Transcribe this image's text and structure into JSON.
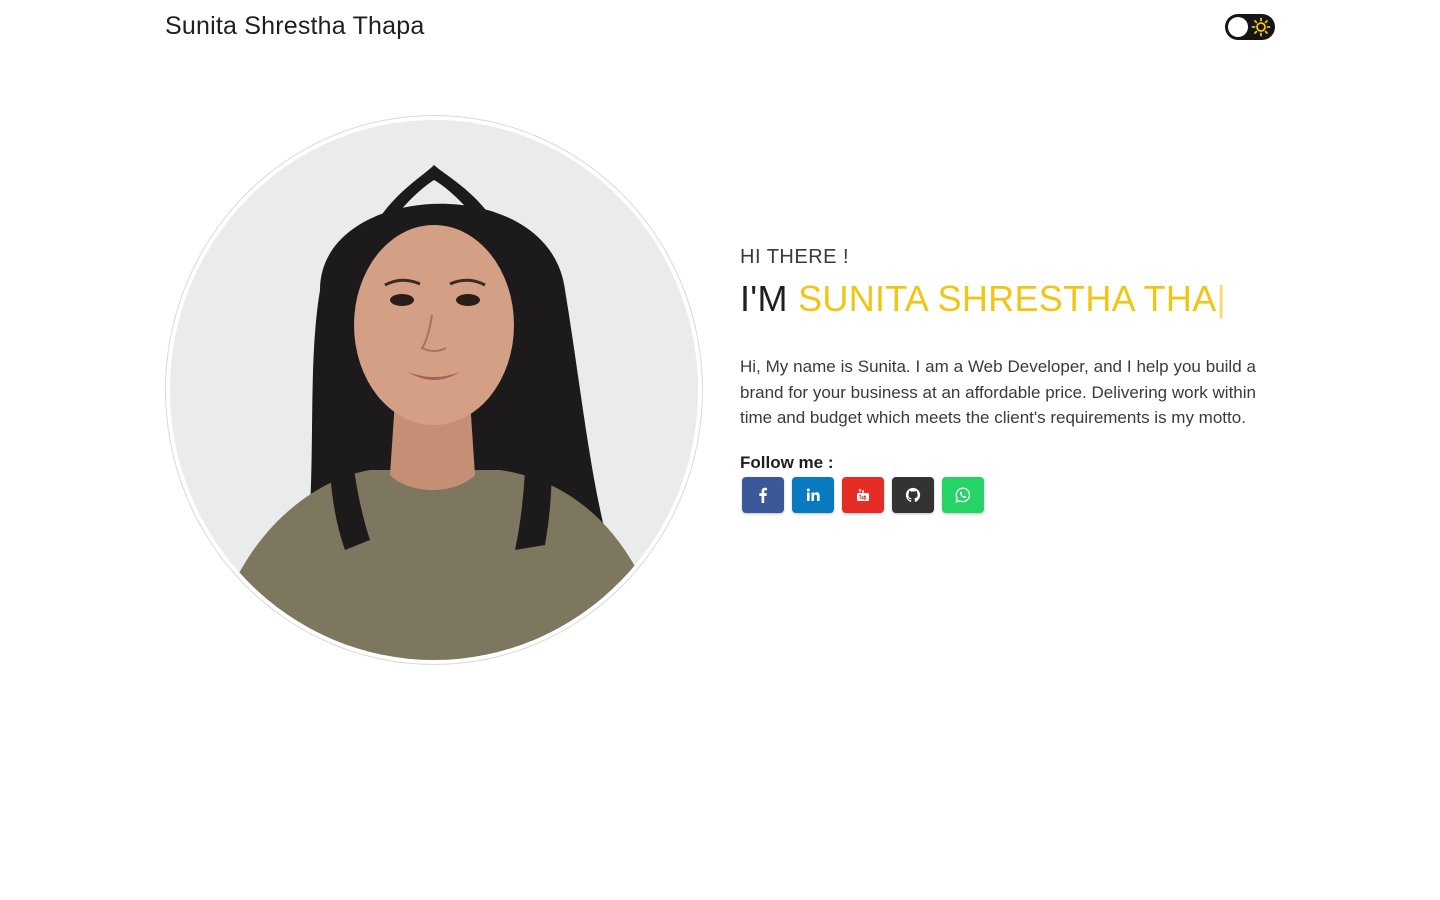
{
  "navbar": {
    "brand": "Sunita Shrestha Thapa",
    "theme_toggle_icon": "sun-icon"
  },
  "hero": {
    "greeting": "HI THERE !",
    "headline_prefix": "I'M ",
    "headline_name": "SUNITA SHRESTHA THA",
    "cursor": "|",
    "bio": "Hi, My name is Sunita. I am a Web Developer, and I help you build a brand for your business at an affordable price. Delivering work within time and budget which meets the client's requirements is my motto.",
    "follow_label": "Follow me :",
    "socials": [
      {
        "icon": "facebook-icon",
        "color": "#3b5998"
      },
      {
        "icon": "linkedin-icon",
        "color": "#0a7ac0"
      },
      {
        "icon": "youtube-icon",
        "color": "#e52d27"
      },
      {
        "icon": "github-icon",
        "color": "#333333"
      },
      {
        "icon": "whatsapp-icon",
        "color": "#25d366"
      }
    ]
  },
  "colors": {
    "accent": "#f0c514",
    "text": "#1f1f1f",
    "toggle_bg": "#151515"
  }
}
